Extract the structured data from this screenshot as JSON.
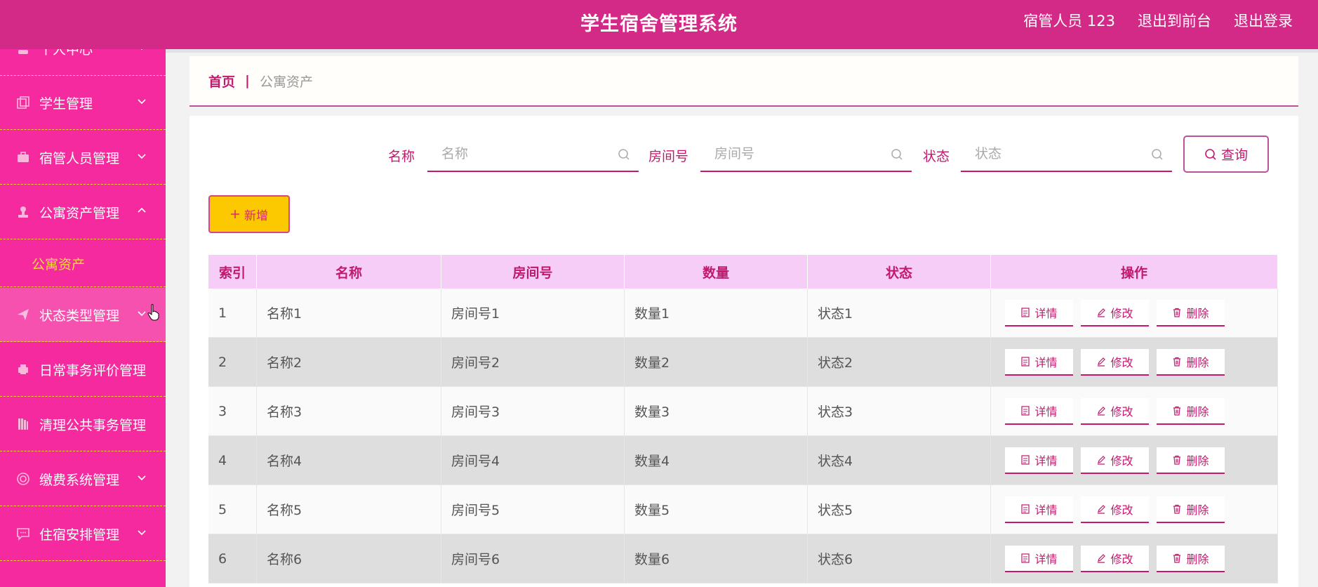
{
  "header": {
    "title": "学生宿舍管理系统",
    "user": "宿管人员 123",
    "back_front": "退出到前台",
    "logout": "退出登录"
  },
  "sidebar": {
    "partial_top": "个人中心",
    "items": [
      {
        "label": "学生管理",
        "icon": "copy-icon"
      },
      {
        "label": "宿管人员管理",
        "icon": "briefcase-icon"
      },
      {
        "label": "公寓资产管理",
        "icon": "stamp-icon"
      },
      {
        "label": "状态类型管理",
        "icon": "send-icon"
      },
      {
        "label": "日常事务评价管理",
        "icon": "printer-icon"
      },
      {
        "label": "清理公共事务管理",
        "icon": "book-icon"
      },
      {
        "label": "缴费系统管理",
        "icon": "circle-icon"
      },
      {
        "label": "住宿安排管理",
        "icon": "chat-icon"
      }
    ],
    "submenu": "公寓资产"
  },
  "breadcrumb": {
    "home": "首页",
    "separator": "|",
    "current": "公寓资产"
  },
  "search": {
    "name_label": "名称",
    "name_placeholder": "名称",
    "room_label": "房间号",
    "room_placeholder": "房间号",
    "status_label": "状态",
    "status_placeholder": "状态",
    "query_label": "查询"
  },
  "add_label": "新增",
  "table": {
    "headers": [
      "索引",
      "名称",
      "房间号",
      "数量",
      "状态",
      "操作"
    ],
    "rows": [
      [
        "1",
        "名称1",
        "房间号1",
        "数量1",
        "状态1"
      ],
      [
        "2",
        "名称2",
        "房间号2",
        "数量2",
        "状态2"
      ],
      [
        "3",
        "名称3",
        "房间号3",
        "数量3",
        "状态3"
      ],
      [
        "4",
        "名称4",
        "房间号4",
        "数量4",
        "状态4"
      ],
      [
        "5",
        "名称5",
        "房间号5",
        "数量5",
        "状态5"
      ],
      [
        "6",
        "名称6",
        "房间号6",
        "数量6",
        "状态6"
      ]
    ],
    "actions": {
      "detail": "详情",
      "edit": "修改",
      "delete": "删除"
    }
  },
  "colors": {
    "header": "#d42a87",
    "sidebar": "#f52a9f",
    "accent": "#c2196e",
    "add_button": "#fcc800"
  }
}
